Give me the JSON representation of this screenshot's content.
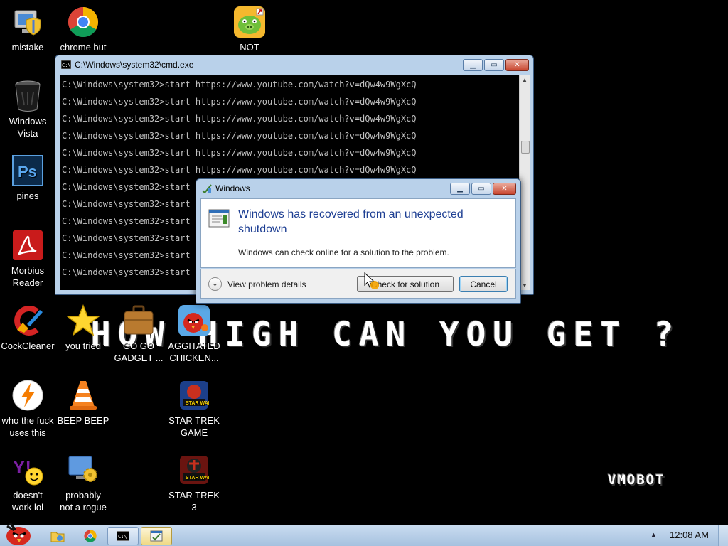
{
  "wallpaper": {
    "headline": "HOW HIGH CAN YOU GET ?",
    "signature": "VMOBOT"
  },
  "desktop_icons": [
    {
      "label_1": "mistake",
      "label_2": "",
      "icon": "computer-shield-icon"
    },
    {
      "label_1": "chrome but",
      "label_2": "",
      "icon": "chrome-icon"
    },
    {
      "label_1": "NOT PISSED",
      "label_2": "",
      "icon": "green-pig-icon"
    },
    {
      "label_1": "Windows",
      "label_2": "Vista",
      "icon": "recycle-bin-icon"
    },
    {
      "label_1": "pines",
      "label_2": "",
      "icon": "photoshop-icon"
    },
    {
      "label_1": "Morbius",
      "label_2": "Reader",
      "icon": "pdf-reader-icon"
    },
    {
      "label_1": "CockCleaner",
      "label_2": "",
      "icon": "ccleaner-icon"
    },
    {
      "label_1": "you tried",
      "label_2": "",
      "icon": "star-icon"
    },
    {
      "label_1": "GO GO",
      "label_2": "GADGET ...",
      "icon": "briefcase-icon"
    },
    {
      "label_1": "AGGITATED",
      "label_2": "CHICKEN...",
      "icon": "angry-bird-icon"
    },
    {
      "label_1": "who the fuck",
      "label_2": "uses this",
      "icon": "avast-icon"
    },
    {
      "label_1": "BEEP BEEP",
      "label_2": "",
      "icon": "traffic-cone-icon"
    },
    {
      "label_1": "STAR TREK",
      "label_2": "GAME",
      "icon": "star-wars-game-icon"
    },
    {
      "label_1": "doesn't",
      "label_2": "work lol",
      "icon": "yahoo-messenger-icon"
    },
    {
      "label_1": "probably",
      "label_2": "not a rogue",
      "icon": "gear-monitor-icon"
    },
    {
      "label_1": "STAR TREK",
      "label_2": "3",
      "icon": "star-wars-game-icon"
    }
  ],
  "cmd_window": {
    "title": "C:\\Windows\\system32\\cmd.exe",
    "prompt": "C:\\Windows\\system32>",
    "command": "start https://www.youtube.com/watch?v=dQw4w9WgXcQ",
    "line_count": 12
  },
  "dialog": {
    "title": "Windows",
    "heading": "Windows has recovered from an unexpected shutdown",
    "message": "Windows can check online for a solution to the problem.",
    "details_label": "View problem details",
    "check_label": "Check for solution",
    "cancel_label": "Cancel"
  },
  "taskbar": {
    "clock": "12:08 AM",
    "pinned": [
      "explorer-icon",
      "chrome-icon"
    ],
    "tasks": [
      "cmd-icon",
      "error-dialog-icon"
    ]
  },
  "colors": {
    "dialog_heading": "#1e3f93",
    "titlebar": "#b9d1ea",
    "taskbar": "#a6c1df"
  }
}
